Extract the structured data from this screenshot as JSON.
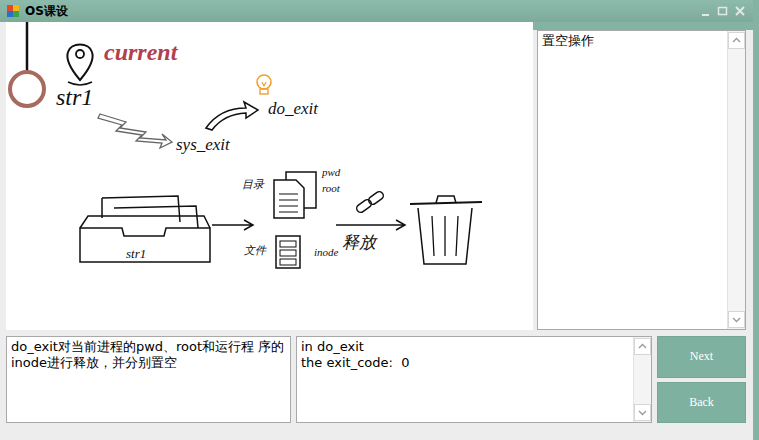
{
  "window": {
    "title": "OS课设"
  },
  "diagram": {
    "pointer": "current",
    "process": "str1",
    "call": "sys_exit",
    "handler": "do_exit",
    "tray_label": "str1",
    "dir_label": "目录",
    "dir_fields": [
      "pwd",
      "root"
    ],
    "file_label": "文件",
    "file_field": "inode",
    "action": "释放"
  },
  "side_panel": {
    "text": "置空操作"
  },
  "description": {
    "text": "do_exit对当前进程的pwd、root和运行程 序的inode进行释放，并分别置空"
  },
  "log": {
    "lines": [
      "in do_exit",
      "the exit_code:  0"
    ]
  },
  "buttons": [
    {
      "label": "Next"
    },
    {
      "label": "Back"
    }
  ]
}
